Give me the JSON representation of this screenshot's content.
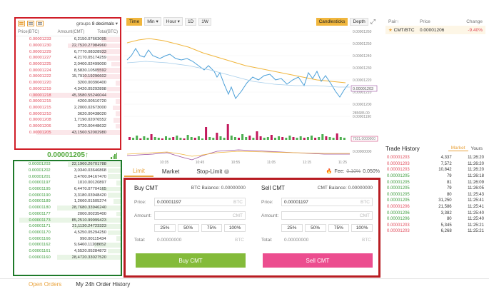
{
  "orderbook": {
    "groups_label": "groups",
    "groups_value": "8 decimals",
    "columns": [
      "Price(BTC)",
      "Amount(CMT)",
      "Total(BTC)"
    ],
    "asks": [
      {
        "price": "0.00001233",
        "amount": "6,215",
        "total": "0.07663095",
        "depth": 0.18
      },
      {
        "price": "0.00001230",
        "amount": "22,752",
        "total": "0.27984960",
        "depth": 0.5
      },
      {
        "price": "0.00001229",
        "amount": "6,777",
        "total": "0.08328933",
        "depth": 0.18
      },
      {
        "price": "0.00001227",
        "amount": "4,217",
        "total": "0.05174259",
        "depth": 0.12
      },
      {
        "price": "0.00001225",
        "amount": "2,040",
        "total": "0.02499000",
        "depth": 0.08
      },
      {
        "price": "0.00001224",
        "amount": "8,583",
        "total": "0.10505592",
        "depth": 0.22
      },
      {
        "price": "0.00001222",
        "amount": "15,791",
        "total": "0.19296602",
        "depth": 0.35
      },
      {
        "price": "0.00001220",
        "amount": "320",
        "total": "0.00390400",
        "depth": 0.04
      },
      {
        "price": "0.00001219",
        "amount": "4,342",
        "total": "0.05292898",
        "depth": 0.12
      },
      {
        "price": "0.00001218",
        "amount": "45,358",
        "total": "0.55246044",
        "depth": 0.85
      },
      {
        "price": "0.00001215",
        "amount": "420",
        "total": "0.00510720",
        "depth": 0.04
      },
      {
        "price": "0.00001215",
        "amount": "2,200",
        "total": "0.02673000",
        "depth": 0.07
      },
      {
        "price": "0.00001210",
        "amount": "362",
        "total": "0.00438020",
        "depth": 0.04
      },
      {
        "price": "0.00001208",
        "amount": "1,719",
        "total": "0.02076552",
        "depth": 0.06
      },
      {
        "price": "0.00001206",
        "amount": "372",
        "total": "0.00448632",
        "depth": 0.04
      },
      {
        "price": "0.00001205",
        "amount": "43,156",
        "total": "0.52002980",
        "depth": 0.8
      }
    ],
    "last_price": "0.00001205↑",
    "bids": [
      {
        "price": "0.00001203",
        "amount": "22,196",
        "total": "0.26701788",
        "depth": 0.5
      },
      {
        "price": "0.00001202",
        "amount": "3,034",
        "total": "0.03646868",
        "depth": 0.12
      },
      {
        "price": "0.00001201",
        "amount": "3,470",
        "total": "0.04167470",
        "depth": 0.12
      },
      {
        "price": "0.00001197",
        "amount": "101",
        "total": "0.00120897",
        "depth": 0.04
      },
      {
        "price": "0.00001195",
        "amount": "6,447",
        "total": "0.07704165",
        "depth": 0.18
      },
      {
        "price": "0.00001190",
        "amount": "3,318",
        "total": "0.03948420",
        "depth": 0.12
      },
      {
        "price": "0.00001189",
        "amount": "1,266",
        "total": "0.01505274",
        "depth": 0.07
      },
      {
        "price": "0.00001180",
        "amount": "28,768",
        "total": "0.33946240",
        "depth": 0.6
      },
      {
        "price": "0.00001177",
        "amount": "200",
        "total": "0.00235400",
        "depth": 0.04
      },
      {
        "price": "0.00001173",
        "amount": "85,251",
        "total": "0.99999423",
        "depth": 0.95
      },
      {
        "price": "0.00001171",
        "amount": "21,113",
        "total": "0.24723323",
        "depth": 0.45
      },
      {
        "price": "0.00001170",
        "amount": "4,525",
        "total": "0.05294250",
        "depth": 0.12
      },
      {
        "price": "0.00001166",
        "amount": "99",
        "total": "0.00115434",
        "depth": 0.04
      },
      {
        "price": "0.00001162",
        "amount": "9,646",
        "total": "0.11208652",
        "depth": 0.25
      },
      {
        "price": "0.00001161",
        "amount": "4,552",
        "total": "0.05284872",
        "depth": 0.12
      },
      {
        "price": "0.00001160",
        "amount": "28,472",
        "total": "0.33027520",
        "depth": 0.6
      }
    ]
  },
  "chart": {
    "toolbar": {
      "time": "Time",
      "min": "Min",
      "hour": "Hour",
      "d1": "1D",
      "w1": "1W",
      "candlesticks": "Candlesticks",
      "depth": "Depth"
    },
    "price_ticks": [
      "0.00001260",
      "0.00001250",
      "0.00001240",
      "0.00001230",
      "0.00001220",
      "0.00001210",
      "0.00001200",
      "0.00001190"
    ],
    "current_price_tag": "0.00001203",
    "volume_ticks": [
      "285685.00",
      "7021.0000000",
      "0.00000000"
    ],
    "time_ticks": [
      "10:35",
      "10:45",
      "10:55",
      "11:05",
      "11:15",
      "11:25"
    ]
  },
  "order_form": {
    "tabs": [
      "Limit",
      "Market",
      "Stop-Limit"
    ],
    "active_tab": "Limit",
    "fee_label": "Fee:",
    "fee_old": "0.10%",
    "fee_new": "0.050%",
    "buy": {
      "title": "Buy CMT",
      "balance": "BTC Balance: 0.00000000",
      "price_label": "Price:",
      "price": "0.00001197",
      "price_unit": "BTC",
      "amount_label": "Amount:",
      "amount_unit": "CMT",
      "pcts": [
        "25%",
        "50%",
        "75%",
        "100%"
      ],
      "total_label": "Total:",
      "total": "0.00000000",
      "total_unit": "BTC",
      "button": "Buy CMT",
      "color": "#84bb3a"
    },
    "sell": {
      "title": "Sell CMT",
      "balance": "CMT Balance: 0.00000000",
      "price_label": "Price:",
      "price": "0.00001197",
      "price_unit": "BTC",
      "amount_label": "Amount:",
      "amount_unit": "CMT",
      "pcts": [
        "25%",
        "50%",
        "75%",
        "100%"
      ],
      "total_label": "Total:",
      "total": "0.00000000",
      "total_unit": "BTC",
      "button": "Sell CMT",
      "color": "#ec4d8f"
    }
  },
  "pairs": {
    "columns": [
      "Pair↑",
      "Price",
      "Change"
    ],
    "rows": [
      {
        "pair": "CMT/BTC",
        "price": "0.00001206",
        "change": "-9.40%"
      }
    ]
  },
  "trade_history": {
    "title": "Trade History",
    "tabs": [
      "Market",
      "Yours"
    ],
    "rows": [
      {
        "price": "0.00001203",
        "amount": "4,337",
        "time": "11:26:20",
        "side": "sell"
      },
      {
        "price": "0.00001203",
        "amount": "7,572",
        "time": "11:26:20",
        "side": "sell"
      },
      {
        "price": "0.00001203",
        "amount": "10,842",
        "time": "11:26:20",
        "side": "sell"
      },
      {
        "price": "0.00001205",
        "amount": "79",
        "time": "11:26:18",
        "side": "buy"
      },
      {
        "price": "0.00001205",
        "amount": "81",
        "time": "11:26:09",
        "side": "buy"
      },
      {
        "price": "0.00001205",
        "amount": "79",
        "time": "11:26:05",
        "side": "buy"
      },
      {
        "price": "0.00001205",
        "amount": "80",
        "time": "11:25:43",
        "side": "buy"
      },
      {
        "price": "0.00001205",
        "amount": "31,250",
        "time": "11:25:41",
        "side": "buy"
      },
      {
        "price": "0.00001206",
        "amount": "21,586",
        "time": "11:25:41",
        "side": "sell"
      },
      {
        "price": "0.00001206",
        "amount": "3,382",
        "time": "11:25:40",
        "side": "buy"
      },
      {
        "price": "0.00001206",
        "amount": "80",
        "time": "11:25:40",
        "side": "buy"
      },
      {
        "price": "0.00001203",
        "amount": "5,345",
        "time": "11:25:21",
        "side": "sell"
      },
      {
        "price": "0.00001203",
        "amount": "6,268",
        "time": "11:25:21",
        "side": "sell"
      }
    ]
  },
  "bottom_tabs": [
    "Open Orders",
    "My 24h Order History"
  ]
}
